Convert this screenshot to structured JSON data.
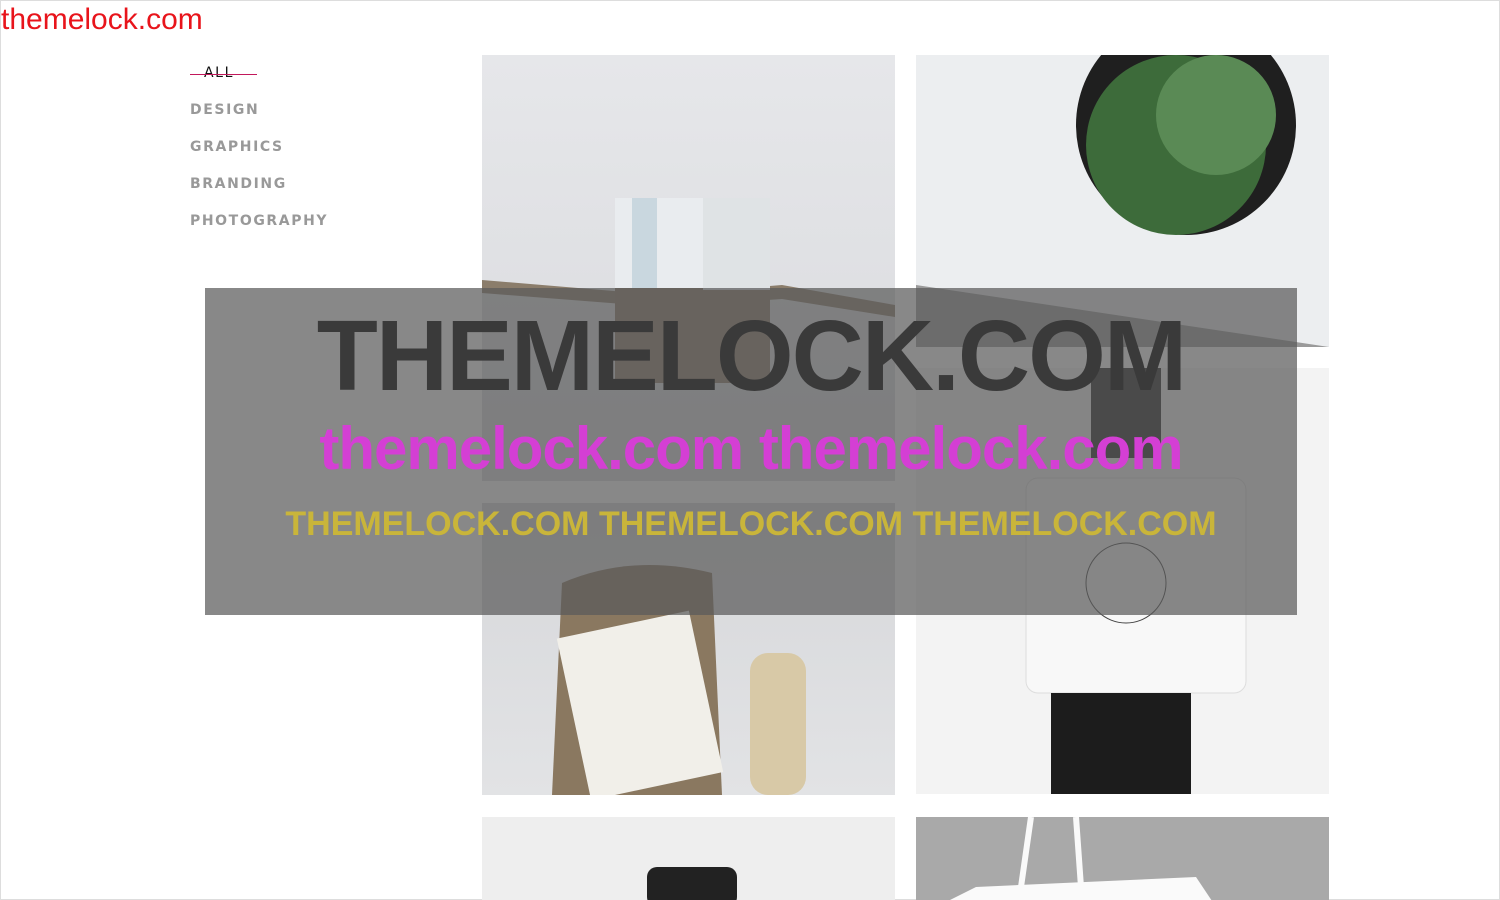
{
  "watermark": {
    "corner": "themelock.com",
    "line1": "THEMELOCK.COM",
    "line2": "themelock.com themelock.com",
    "line3": "THEMELOCK.COM THEMELOCK.COM THEMELOCK.COM"
  },
  "filters": [
    {
      "label": "ALL",
      "active": true
    },
    {
      "label": "DESIGN"
    },
    {
      "label": "GRAPHICS"
    },
    {
      "label": "BRANDING"
    },
    {
      "label": "PHOTOGRAPHY"
    }
  ],
  "portfolio": [
    {
      "alt": "Callebaut packaging box"
    },
    {
      "alt": "Gaze card with plant"
    },
    {
      "alt": "Coffee sack and bottle"
    },
    {
      "alt": "Backpacks totes bag"
    },
    {
      "alt": "Product photo"
    },
    {
      "alt": "Tote bag"
    }
  ],
  "colors": {
    "accent": "#c2185b",
    "watermark_red": "#e8141b"
  }
}
